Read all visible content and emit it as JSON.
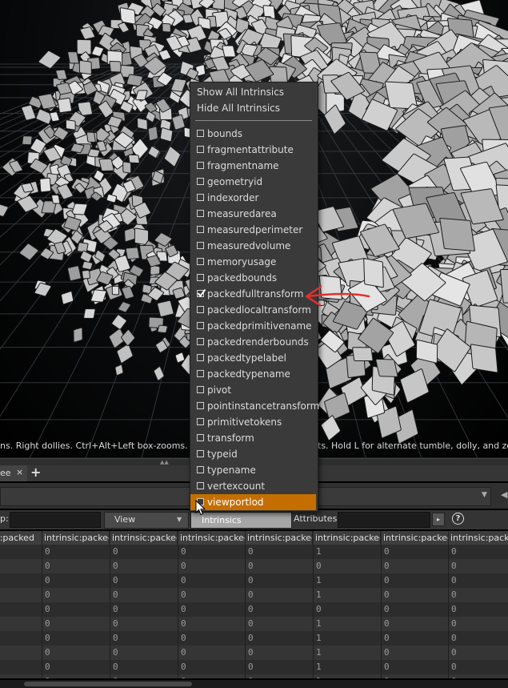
{
  "viewport": {
    "hint_left": "ns. Right dollies. Ctrl+Alt+Left box-zooms. Ctrl+Ri",
    "hint_right": "ts. Hold L for alternate tumble, dolly, and zoom."
  },
  "tabbar": {
    "tab_label": "ee",
    "close_glyph": "×",
    "add_glyph": "+"
  },
  "filterbar": {
    "group_label": "p:",
    "view_label": "View",
    "intrinsics_label": "Intrinsics",
    "attributes_label": "Attributes:",
    "help_glyph": "?"
  },
  "menu": {
    "show_all": "Show All Intrinsics",
    "hide_all": "Hide All Intrinsics",
    "items": [
      {
        "label": "bounds",
        "checked": false
      },
      {
        "label": "fragmentattribute",
        "checked": false
      },
      {
        "label": "fragmentname",
        "checked": false
      },
      {
        "label": "geometryid",
        "checked": false
      },
      {
        "label": "indexorder",
        "checked": false
      },
      {
        "label": "measuredarea",
        "checked": false
      },
      {
        "label": "measuredperimeter",
        "checked": false
      },
      {
        "label": "measuredvolume",
        "checked": false
      },
      {
        "label": "memoryusage",
        "checked": false
      },
      {
        "label": "packedbounds",
        "checked": false
      },
      {
        "label": "packedfulltransform",
        "checked": true
      },
      {
        "label": "packedlocaltransform",
        "checked": false
      },
      {
        "label": "packedprimitivename",
        "checked": false
      },
      {
        "label": "packedrenderbounds",
        "checked": false
      },
      {
        "label": "packedtypelabel",
        "checked": false
      },
      {
        "label": "packedtypename",
        "checked": false
      },
      {
        "label": "pivot",
        "checked": false
      },
      {
        "label": "pointinstancetransform",
        "checked": false
      },
      {
        "label": "primitivetokens",
        "checked": false
      },
      {
        "label": "transform",
        "checked": false
      },
      {
        "label": "typeid",
        "checked": false
      },
      {
        "label": "typename",
        "checked": false
      },
      {
        "label": "vertexcount",
        "checked": false
      },
      {
        "label": "viewportlod",
        "checked": false,
        "highlighted": true
      }
    ]
  },
  "spreadsheet": {
    "headers": [
      "intrinsic:packed",
      "intrinsic:packed",
      "intrinsic:packed",
      "intrinsic:packed",
      "intrinsic:packed",
      "intrinsic:packed",
      "intrinsic:packed",
      "intrinsic:packed"
    ],
    "rows": [
      [
        "0",
        "0",
        "0",
        "0",
        "1",
        "0",
        "0"
      ],
      [
        "0",
        "0",
        "0",
        "0",
        "0",
        "0",
        "0"
      ],
      [
        "0",
        "0",
        "0",
        "0",
        "1",
        "0",
        "0"
      ],
      [
        "0",
        "0",
        "0",
        "0",
        "1",
        "0",
        "0"
      ],
      [
        "0",
        "0",
        "0",
        "0",
        "0",
        "0",
        "0"
      ],
      [
        "0",
        "0",
        "0",
        "0",
        "1",
        "0",
        "0"
      ],
      [
        "0",
        "0",
        "0",
        "0",
        "1",
        "0",
        "0"
      ],
      [
        "0",
        "0",
        "0",
        "0",
        "1",
        "0",
        "0"
      ],
      [
        "0",
        "0",
        "0",
        "0",
        "1",
        "0",
        "0"
      ],
      [
        "0",
        "0",
        "0",
        "0",
        "1",
        "0",
        "0"
      ]
    ]
  },
  "colors": {
    "highlight": "#c46e00",
    "annotation": "#e0312d"
  }
}
